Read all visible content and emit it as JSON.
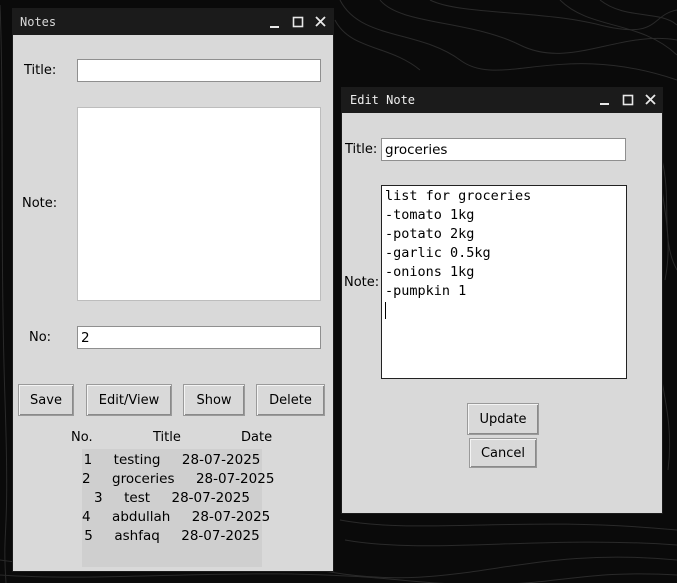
{
  "notes_window": {
    "title": "Notes",
    "title_label": "Title:",
    "title_value": "",
    "note_label": "Note:",
    "no_label": "No:",
    "no_value": "2",
    "buttons": {
      "save": "Save",
      "edit_view": "Edit/View",
      "show": "Show",
      "delete": "Delete"
    },
    "headers": {
      "no": "No.",
      "title": "Title",
      "date": "Date"
    },
    "rows": [
      {
        "text": "1     testing     28-07-2025"
      },
      {
        "text": "2     groceries     28-07-2025"
      },
      {
        "text": "3     test     28-07-2025"
      },
      {
        "text": "4     abdullah     28-07-2025"
      },
      {
        "text": "5     ashfaq     28-07-2025"
      }
    ]
  },
  "edit_window": {
    "title": "Edit Note",
    "title_label": "Title:",
    "title_value": "groceries",
    "note_label": "Note:",
    "note_lines": [
      "list for groceries",
      "-tomato 1kg",
      "-potato 2kg",
      "-garlic 0.5kg",
      "-onions 1kg",
      "-pumpkin 1"
    ],
    "buttons": {
      "update": "Update",
      "cancel": "Cancel"
    }
  },
  "window_controls": {
    "minimize": "minimize-icon",
    "maximize": "maximize-icon",
    "close": "close-icon"
  }
}
